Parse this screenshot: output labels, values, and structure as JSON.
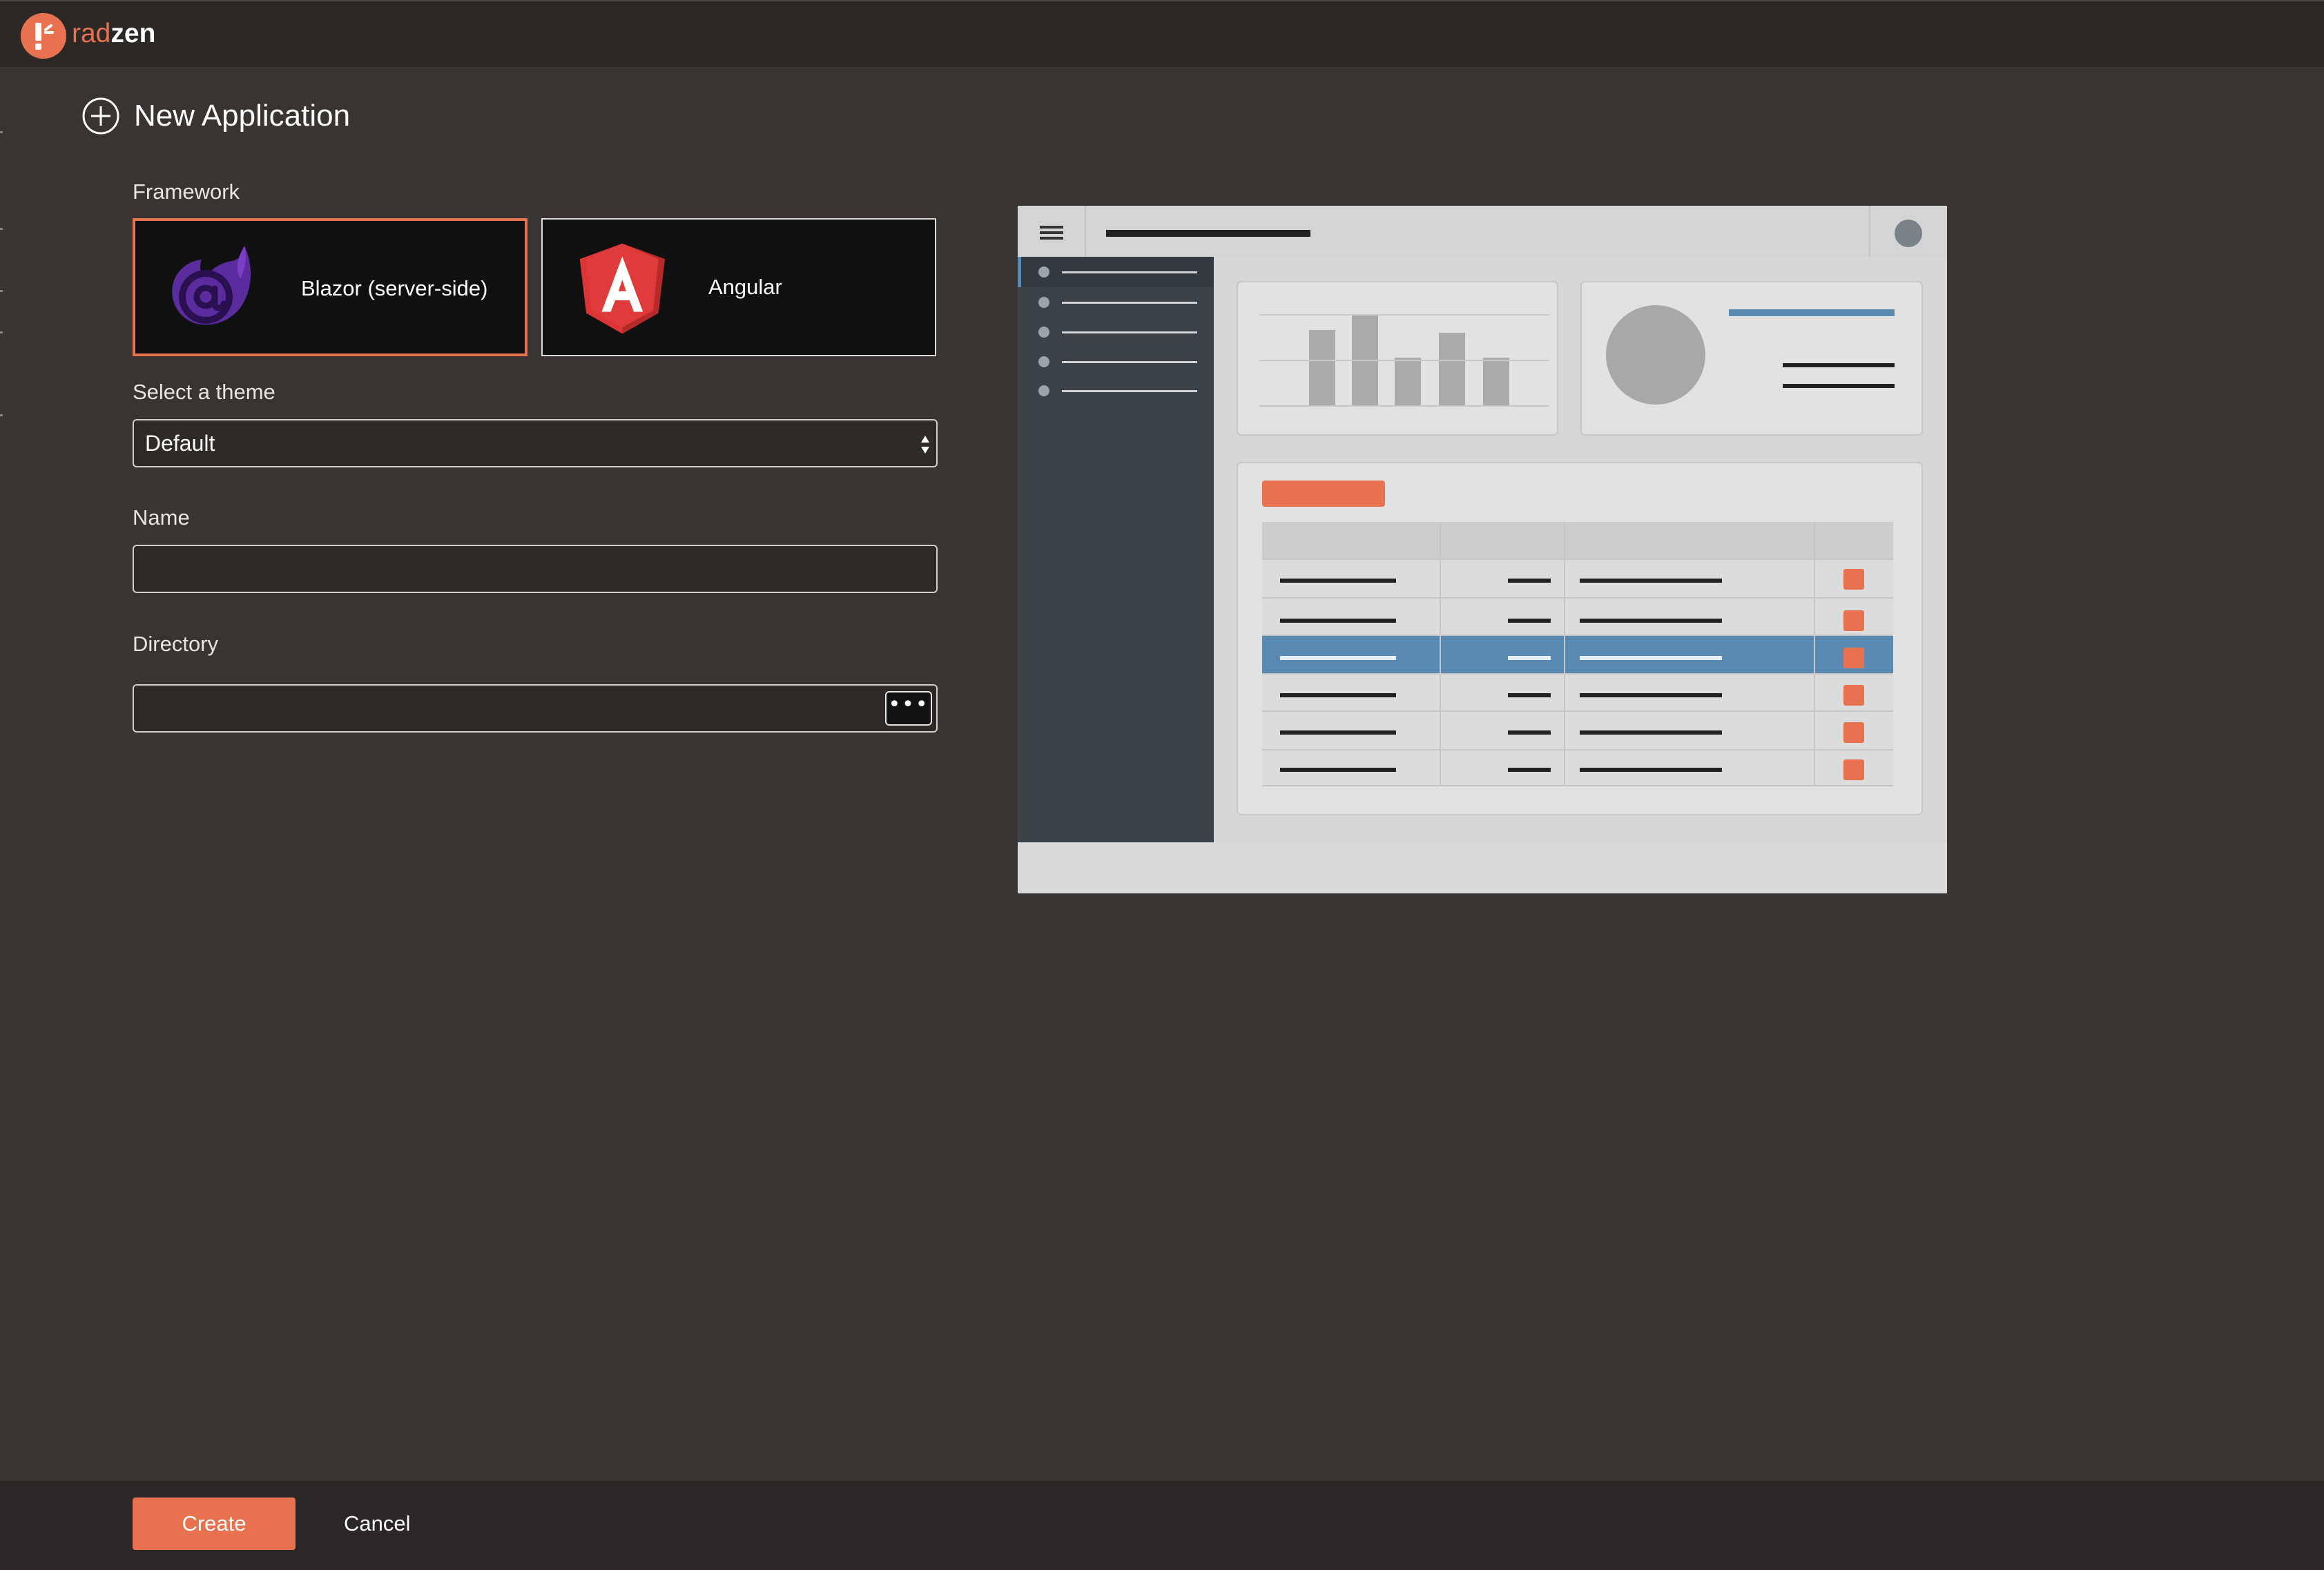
{
  "app": {
    "logo_part1": "rad",
    "logo_part2": "zen"
  },
  "page": {
    "title": "New Application",
    "title_icon": "plus-circle-icon"
  },
  "form": {
    "framework_label": "Framework",
    "frameworks": [
      {
        "label": "Blazor (server-side)",
        "icon": "blazor-icon",
        "selected": true
      },
      {
        "label": "Angular",
        "icon": "angular-icon",
        "selected": false
      }
    ],
    "theme_label": "Select a theme",
    "theme_value": "Default",
    "name_label": "Name",
    "name_value": "",
    "directory_label": "Directory",
    "directory_value": "",
    "browse_label": "•••"
  },
  "preview": {
    "description": "theme-preview",
    "accent_color": "#e8714f",
    "highlight_color": "#5a89b1"
  },
  "footer": {
    "create_label": "Create",
    "cancel_label": "Cancel"
  },
  "colors": {
    "background": "#393431",
    "topbar": "#2b2826",
    "accent": "#e8714f"
  }
}
